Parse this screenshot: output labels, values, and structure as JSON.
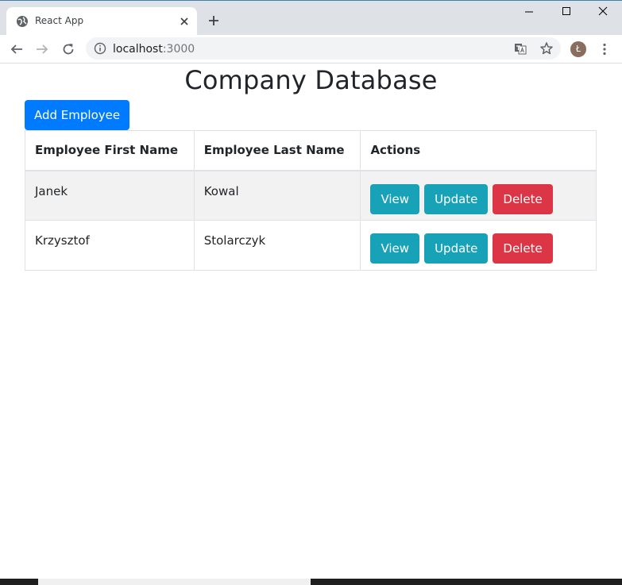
{
  "browser": {
    "tab_title": "React App",
    "url_host": "localhost",
    "url_port": ":3000",
    "profile_initial": "Ł"
  },
  "page": {
    "title": "Company Database",
    "add_button_label": "Add Employee",
    "colors": {
      "primary": "#007bff",
      "info": "#17a2b8",
      "danger": "#dc3545",
      "stripe": "#f2f2f2"
    }
  },
  "table": {
    "headers": [
      "Employee First Name",
      "Employee Last Name",
      "Actions"
    ],
    "rows": [
      {
        "first_name": "Janek",
        "last_name": "Kowal"
      },
      {
        "first_name": "Krzysztof",
        "last_name": "Stolarczyk"
      }
    ],
    "action_labels": {
      "view": "View",
      "update": "Update",
      "delete": "Delete"
    }
  }
}
